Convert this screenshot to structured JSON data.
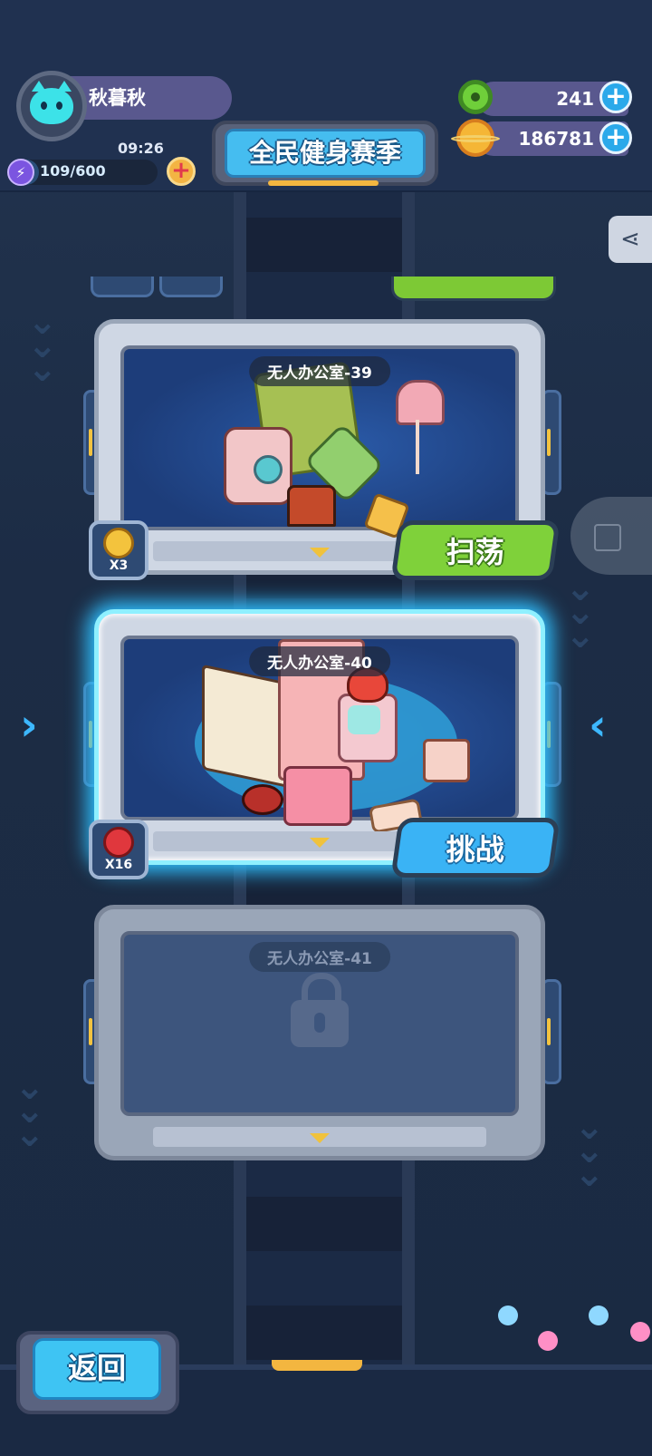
{
  "player": {
    "name": "秋暮秋",
    "timer": "09:26",
    "energy": "109/600",
    "energy_fraction": 0.18
  },
  "season_title": "全民健身赛季",
  "currencies": [
    {
      "icon": "green-donut-icon",
      "value": "241"
    },
    {
      "icon": "golden-planet-icon",
      "value": "186781"
    }
  ],
  "levels": [
    {
      "name": "无人办公室-39",
      "state": "cleared",
      "badge_count": "X3",
      "badge_icon": "gold-star-badge-icon",
      "button": "扫荡"
    },
    {
      "name": "无人办公室-40",
      "state": "current",
      "badge_count": "X16",
      "badge_icon": "red-flame-badge-icon",
      "button": "挑战"
    },
    {
      "name": "无人办公室-41",
      "state": "locked"
    }
  ],
  "back_button": "返回",
  "colors": {
    "accent_blue": "#3ab3f5",
    "sweep_green": "#7fd13a",
    "background": "#1e2f4a",
    "gold": "#f3b640"
  }
}
